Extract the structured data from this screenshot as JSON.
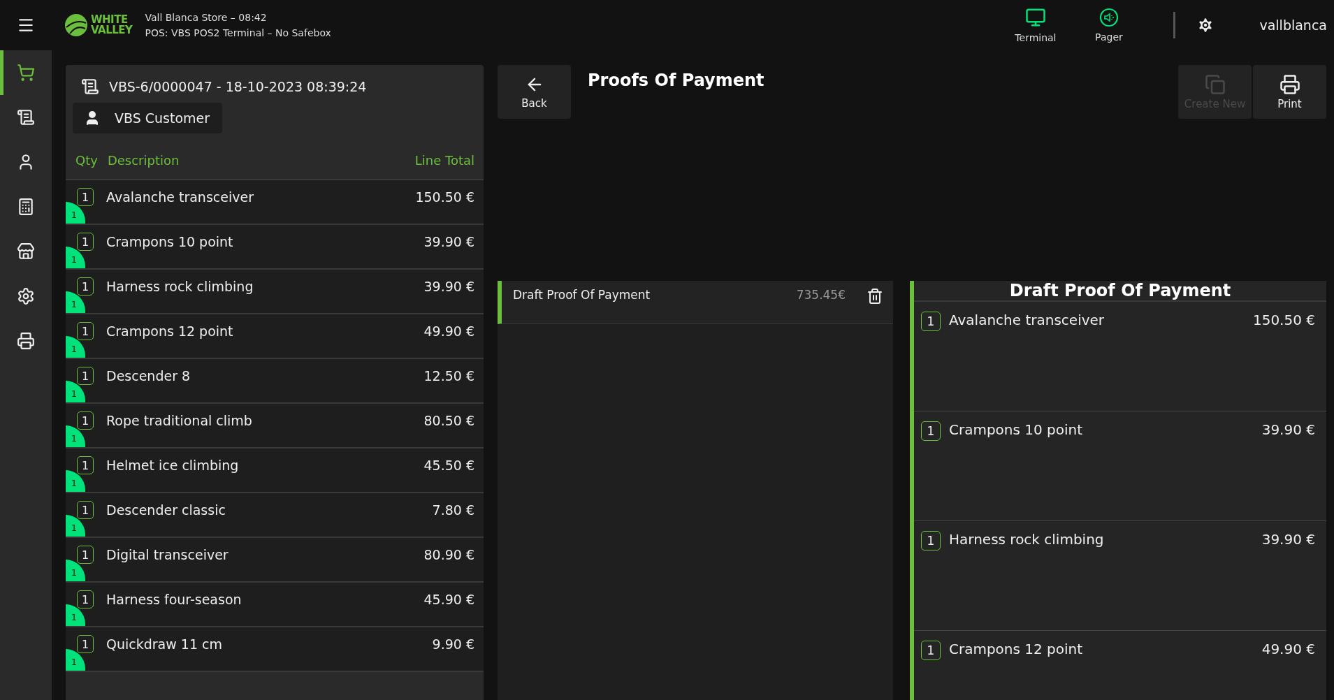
{
  "header": {
    "logo": [
      "WHITE",
      "VALLEY"
    ],
    "store_line": "Vall Blanca Store – 08:42",
    "pos_line": "POS: VBS POS2 Terminal – No Safebox",
    "tools": [
      {
        "kind": "terminal",
        "label": "Terminal"
      },
      {
        "kind": "pager",
        "label": "Pager"
      }
    ],
    "user": "vallblanca"
  },
  "sidebar": {
    "items": [
      {
        "kind": "cart",
        "selected": true
      },
      {
        "kind": "receipt",
        "selected": false
      },
      {
        "kind": "customer",
        "selected": false
      },
      {
        "kind": "register",
        "selected": false
      },
      {
        "kind": "store",
        "selected": false
      },
      {
        "kind": "settings",
        "selected": false
      },
      {
        "kind": "printer",
        "selected": false
      }
    ]
  },
  "ticket": {
    "title": "VBS-6/0000047 - 18-10-2023 08:39:24",
    "customer": "VBS Customer",
    "columns": [
      "Qty",
      "Description",
      "Line Total"
    ],
    "lines": [
      {
        "qty": "1",
        "badge": "1",
        "description": "Avalanche transceiver",
        "total": "150.50 €"
      },
      {
        "qty": "1",
        "badge": "1",
        "description": "Crampons 10 point",
        "total": "39.90 €"
      },
      {
        "qty": "1",
        "badge": "1",
        "description": "Harness rock climbing",
        "total": "39.90 €"
      },
      {
        "qty": "1",
        "badge": "1",
        "description": "Crampons 12 point",
        "total": "49.90 €"
      },
      {
        "qty": "1",
        "badge": "1",
        "description": "Descender 8",
        "total": "12.50 €"
      },
      {
        "qty": "1",
        "badge": "1",
        "description": "Rope traditional climb",
        "total": "80.50 €"
      },
      {
        "qty": "1",
        "badge": "1",
        "description": "Helmet ice climbing",
        "total": "45.50 €"
      },
      {
        "qty": "1",
        "badge": "1",
        "description": "Descender classic",
        "total": "7.80 €"
      },
      {
        "qty": "1",
        "badge": "1",
        "description": "Digital transceiver",
        "total": "80.90 €"
      },
      {
        "qty": "1",
        "badge": "1",
        "description": "Harness four-season",
        "total": "45.90 €"
      },
      {
        "qty": "1",
        "badge": "1",
        "description": "Quickdraw 11 cm",
        "total": "9.90 €"
      }
    ]
  },
  "proofs": {
    "back": "Back",
    "title": "Proofs Of Payment",
    "actions": [
      {
        "kind": "create",
        "label": "Create New",
        "disabled": true
      },
      {
        "kind": "print",
        "label": "Print",
        "disabled": false
      }
    ],
    "list": [
      {
        "name": "Draft Proof Of Payment",
        "amount": "735.45€",
        "selected": true
      }
    ],
    "detail": {
      "title": "Draft Proof Of Payment",
      "lines": [
        {
          "qty": "1",
          "description": "Avalanche transceiver",
          "total": "150.50 €"
        },
        {
          "qty": "1",
          "description": "Crampons 10 point",
          "total": "39.90 €"
        },
        {
          "qty": "1",
          "description": "Harness rock climbing",
          "total": "39.90 €"
        },
        {
          "qty": "1",
          "description": "Crampons 12 point",
          "total": "49.90 €"
        }
      ]
    }
  }
}
